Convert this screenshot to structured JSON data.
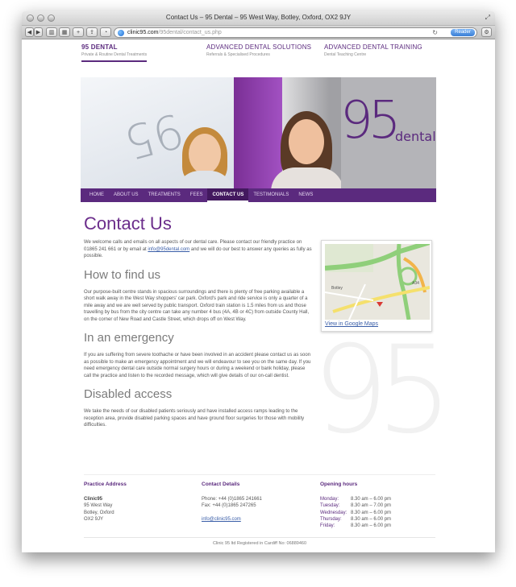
{
  "window": {
    "title": "Contact Us – 95 Dental – 95 West Way, Botley, Oxford, OX2 9JY",
    "url_host": "clinic95.com",
    "url_path": "/95dental/contact_us.php",
    "reader_label": "Reader"
  },
  "brands": [
    {
      "title": "95 DENTAL",
      "subtitle": "Private & Routine Dental Treatments"
    },
    {
      "title": "ADVANCED DENTAL SOLUTIONS",
      "subtitle": "Referrals & Specialised Procedures"
    },
    {
      "title": "ADVANCED DENTAL TRAINING",
      "subtitle": "Dental Teaching Centre"
    }
  ],
  "hero": {
    "logo_number": "95",
    "logo_word": "dental",
    "wall_text": "95"
  },
  "nav": [
    "HOME",
    "ABOUT US",
    "TREATMENTS",
    "FEES",
    "CONTACT US",
    "TESTIMONIALS",
    "NEWS"
  ],
  "content": {
    "heading": "Contact Us",
    "intro_before": "We welcome calls and emails on all aspects of our dental care. Please contact our friendly practice on 01865 241 661 or by email at ",
    "intro_email": "info@95dental.com",
    "intro_after": " and we will do our best to answer any queries as fully as possible.",
    "find_heading": "How to find us",
    "find_text": "Our purpose-built centre stands in spacious surroundings and there is plenty of free parking available a short walk away in the West Way shoppers' car park. Oxford's park and ride service is only a quarter of a mile away and we are well served by public transport. Oxford train station is 1.5 miles from us and those travelling by bus from the city centre can take any number 4 bus (4A, 4B or 4C) from outside County Hall, on the corner of New Road and Castle Street, which drops off on West Way.",
    "emergency_heading": "In an emergency",
    "emergency_text": "If you are suffering from severe toothache or have been involved in an accident please contact us as soon as possible to make an emergency appointment and we will endeavour to see you on the same day. If you need emergency dental care outside normal surgery hours or during a weekend or bank holiday, please call the practice and listen to the recorded message, which will give details of our on-call dentist.",
    "disabled_heading": "Disabled access",
    "disabled_text": "We take the needs of our disabled patients seriously and have installed access ramps leading to the reception area, provide disabled parking spaces and have ground floor surgeries for those with mobility difficulties."
  },
  "map": {
    "link_label": "View in Google Maps",
    "label_botley": "Botley",
    "label_a34": "A34"
  },
  "watermark": "95",
  "footer": {
    "address_heading": "Practice Address",
    "address_name": "Clinic95",
    "address_lines": [
      "95 West Way",
      "Botley, Oxford",
      "OX2 9JY"
    ],
    "contact_heading": "Contact Details",
    "phone": "Phone: +44 (0)1865 241661",
    "fax": "Fax: +44 (0)1865 247265",
    "email": "info@clinic95.com",
    "hours_heading": "Opening hours",
    "hours": [
      {
        "day": "Monday:",
        "time": "8.30 am – 6.00 pm"
      },
      {
        "day": "Tuesday:",
        "time": "8.30 am – 7.00 pm"
      },
      {
        "day": "Wednesday:",
        "time": "8.30 am – 6.00 pm"
      },
      {
        "day": "Thursday:",
        "time": "8.30 am – 6.00 pm"
      },
      {
        "day": "Friday:",
        "time": "8.30 am – 6.00 pm"
      }
    ],
    "copyright": "Clinic 95 ltd Registered in Cardiff No: 06889460"
  },
  "colors": {
    "brand_purple": "#5b2a7e",
    "link_blue": "#3a5ea8"
  }
}
